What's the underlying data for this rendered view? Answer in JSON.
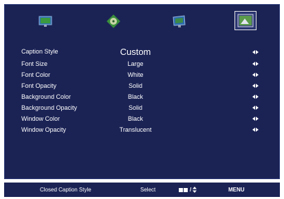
{
  "tabs": [
    {
      "icon": "monitor-icon"
    },
    {
      "icon": "disc-icon"
    },
    {
      "icon": "screen-tilt-icon"
    },
    {
      "icon": "picture-icon",
      "active": true
    }
  ],
  "menu": [
    {
      "label": "Caption Style",
      "value": "Custom"
    },
    {
      "label": "Font Size",
      "value": "Large"
    },
    {
      "label": "Font Color",
      "value": "White"
    },
    {
      "label": "Font Opacity",
      "value": "Solid"
    },
    {
      "label": "Background Color",
      "value": "Black"
    },
    {
      "label": "Background Opacity",
      "value": "Solid"
    },
    {
      "label": "Window Color",
      "value": "Black"
    },
    {
      "label": "Window Opacity",
      "value": "Translucent"
    }
  ],
  "footer": {
    "title": "Closed Caption Style",
    "select": "Select",
    "nav": "/ ",
    "menu": "MENU"
  },
  "colors": {
    "panel_bg": "#1b2355",
    "text": "#ffffff"
  }
}
